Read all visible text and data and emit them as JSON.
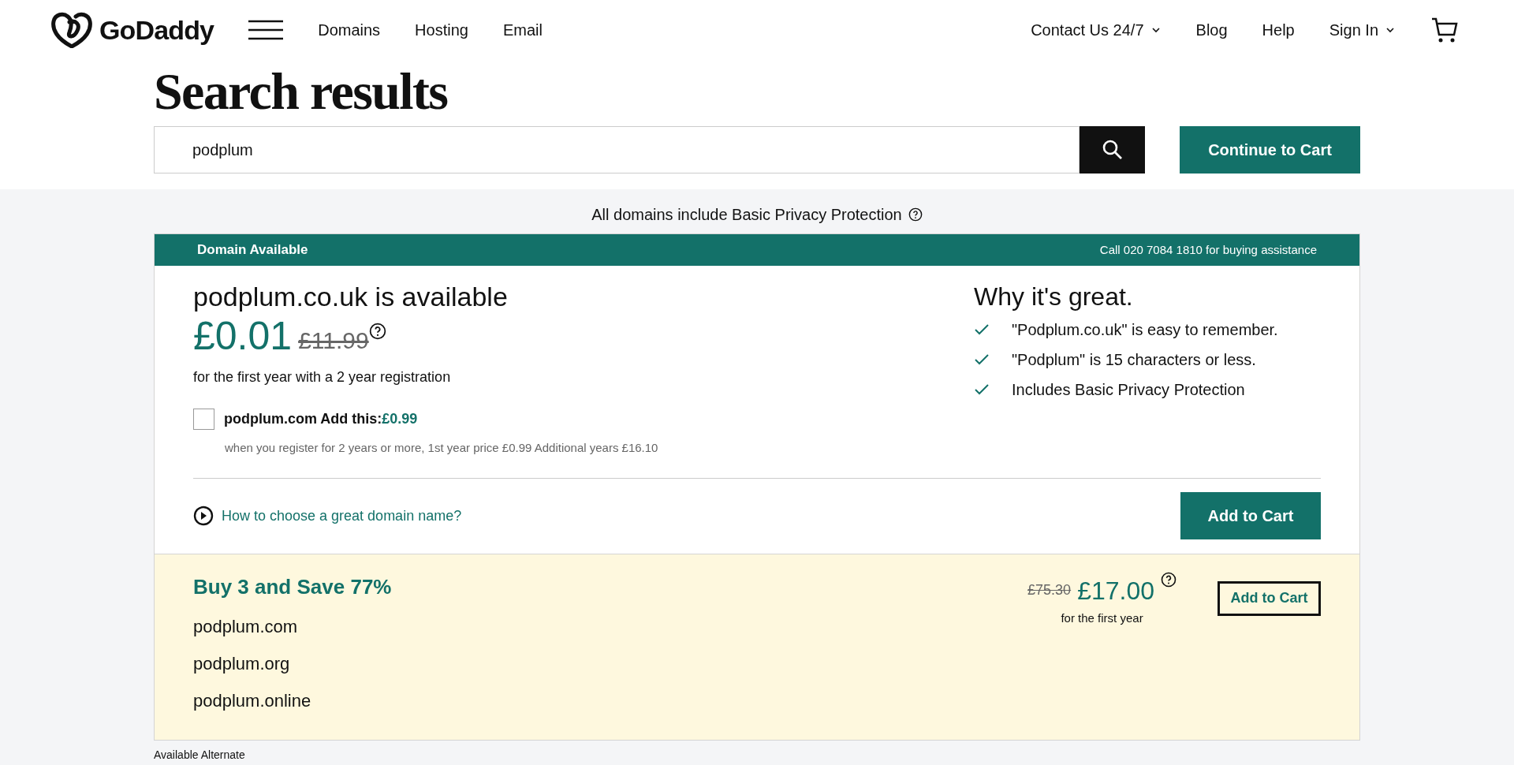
{
  "header": {
    "brand": "GoDaddy",
    "nav": [
      "Domains",
      "Hosting",
      "Email"
    ],
    "right_nav": [
      {
        "label": "Contact Us 24/7",
        "dropdown": true
      },
      {
        "label": "Blog",
        "dropdown": false
      },
      {
        "label": "Help",
        "dropdown": false
      },
      {
        "label": "Sign In",
        "dropdown": true
      }
    ]
  },
  "title": "Search results",
  "search": {
    "value": "podplum",
    "button": "Continue to Cart"
  },
  "privacy_note": "All domains include Basic Privacy Protection",
  "result": {
    "banner": "Domain Available",
    "phone_note": "Call 020 7084 1810 for buying assistance",
    "heading": "podplum.co.uk is available",
    "price": "£0.01",
    "old_price": "£11.99",
    "price_note": "for the first year with a 2 year registration",
    "addon": {
      "checked": false,
      "label": "podplum.com Add this:",
      "price": "£0.99",
      "note": "when you register for 2 years or more, 1st year price £0.99 Additional years £16.10"
    },
    "video_link": "How to choose a great domain name?",
    "add_button": "Add to Cart",
    "why_title": "Why it's great.",
    "reasons": [
      "\"Podplum.co.uk\" is easy to remember.",
      "\"Podplum\" is 15 characters or less.",
      "Includes Basic Privacy Protection"
    ]
  },
  "bundle": {
    "title": "Buy 3 and Save 77%",
    "domains": [
      "podplum.com",
      "podplum.org",
      "podplum.online"
    ],
    "old_price": "£75.30",
    "price": "£17.00",
    "price_note": "for the first year",
    "button": "Add to Cart"
  },
  "alternates": {
    "label": "Available Alternate"
  }
}
